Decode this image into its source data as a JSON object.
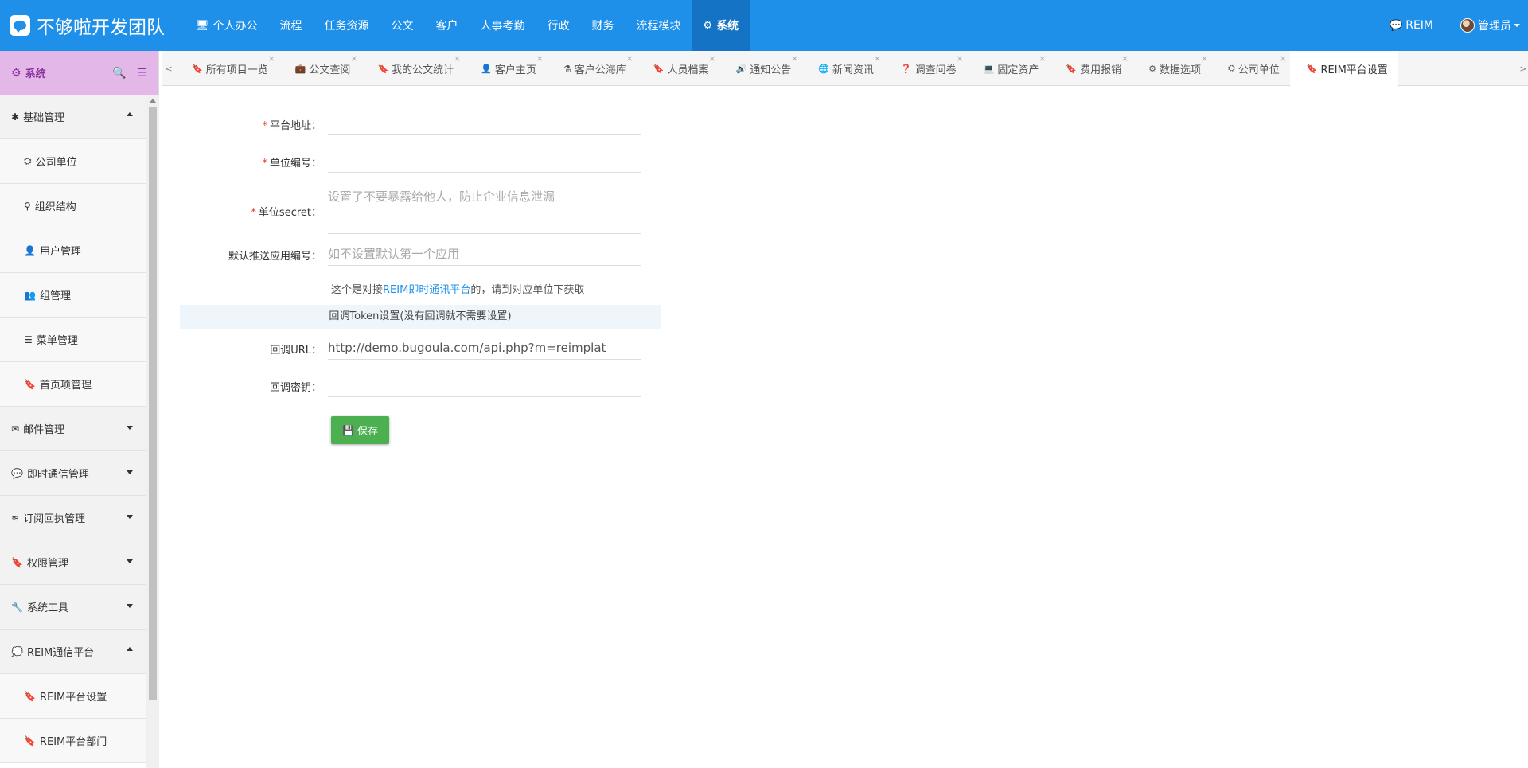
{
  "app": {
    "title": "不够啦开发团队"
  },
  "colors": {
    "primary": "#1e90ea",
    "nav_active": "#1573c5",
    "sidebar_header": "#e3b8e8",
    "required": "#e53935",
    "save_button": "#4caf50",
    "section_bg": "#eef5fb"
  },
  "topnav": {
    "items": [
      {
        "label": "个人办公",
        "icon": "desktop-icon",
        "glyph": "🖥"
      },
      {
        "label": "流程"
      },
      {
        "label": "任务资源"
      },
      {
        "label": "公文"
      },
      {
        "label": "客户"
      },
      {
        "label": "人事考勤"
      },
      {
        "label": "行政"
      },
      {
        "label": "财务"
      },
      {
        "label": "流程模块"
      },
      {
        "label": "系统",
        "icon": "gear-icon",
        "glyph": "⚙",
        "active": true
      }
    ],
    "right": {
      "reim_label": "REIM",
      "user_label": "管理员"
    }
  },
  "sidebar": {
    "title": "系统",
    "items": [
      {
        "label": "基础管理",
        "type": "group",
        "icon": "asterisk-icon",
        "glyph": "✱",
        "expanded": true
      },
      {
        "label": "公司单位",
        "type": "sub",
        "icon": "binoculars-icon",
        "glyph": "⛭"
      },
      {
        "label": "组织结构",
        "type": "sub",
        "icon": "sitemap-icon",
        "glyph": "⚲"
      },
      {
        "label": "用户管理",
        "type": "sub",
        "icon": "user-icon",
        "glyph": "👤"
      },
      {
        "label": "组管理",
        "type": "sub",
        "icon": "users-icon",
        "glyph": "👥"
      },
      {
        "label": "菜单管理",
        "type": "sub",
        "icon": "list-icon",
        "glyph": "☰"
      },
      {
        "label": "首页项管理",
        "type": "sub",
        "icon": "bookmark-icon",
        "glyph": "🔖"
      },
      {
        "label": "邮件管理",
        "type": "group",
        "icon": "envelope-icon",
        "glyph": "✉",
        "expanded": false
      },
      {
        "label": "即时通信管理",
        "type": "group",
        "icon": "comment-icon",
        "glyph": "💬",
        "expanded": false
      },
      {
        "label": "订阅回执管理",
        "type": "group",
        "icon": "rss-icon",
        "glyph": "≋",
        "expanded": false
      },
      {
        "label": "权限管理",
        "type": "group",
        "icon": "bookmark-icon",
        "glyph": "🔖",
        "expanded": false
      },
      {
        "label": "系统工具",
        "type": "group",
        "icon": "wrench-icon",
        "glyph": "🔧",
        "expanded": false
      },
      {
        "label": "REIM通信平台",
        "type": "group",
        "icon": "comment-o-icon",
        "glyph": "💭",
        "expanded": true
      },
      {
        "label": "REIM平台设置",
        "type": "sub",
        "icon": "bookmark-icon",
        "glyph": "🔖"
      },
      {
        "label": "REIM平台部门",
        "type": "sub",
        "icon": "bookmark-icon",
        "glyph": "🔖"
      }
    ]
  },
  "tabs": [
    {
      "label": "所有项目一览",
      "icon": "bookmark-icon",
      "glyph": "🔖"
    },
    {
      "label": "公文查阅",
      "icon": "briefcase-icon",
      "glyph": "💼"
    },
    {
      "label": "我的公文统计",
      "icon": "bookmark-icon",
      "glyph": "🔖"
    },
    {
      "label": "客户主页",
      "icon": "user-tie-icon",
      "glyph": "👤"
    },
    {
      "label": "客户公海库",
      "icon": "flask-icon",
      "glyph": "⚗"
    },
    {
      "label": "人员档案",
      "icon": "bookmark-icon",
      "glyph": "🔖"
    },
    {
      "label": "通知公告",
      "icon": "volume-icon",
      "glyph": "🔊"
    },
    {
      "label": "新闻资讯",
      "icon": "globe-icon",
      "glyph": "🌐"
    },
    {
      "label": "调查问卷",
      "icon": "question-circle-icon",
      "glyph": "❓"
    },
    {
      "label": "固定资产",
      "icon": "laptop-icon",
      "glyph": "💻"
    },
    {
      "label": "费用报销",
      "icon": "bookmark-icon",
      "glyph": "🔖"
    },
    {
      "label": "数据选项",
      "icon": "gear-icon",
      "glyph": "⚙"
    },
    {
      "label": "公司单位",
      "icon": "binoculars-icon",
      "glyph": "⛭"
    },
    {
      "label": "REIM平台设置",
      "icon": "bookmark-icon",
      "glyph": "🔖",
      "active": true
    }
  ],
  "form": {
    "platform_url": {
      "label": "平台地址：",
      "required": true,
      "value": "",
      "placeholder": ""
    },
    "unit_id": {
      "label": "单位编号：",
      "required": true,
      "value": "",
      "placeholder": ""
    },
    "unit_secret": {
      "label": "单位secret：",
      "required": true,
      "value": "",
      "placeholder": "设置了不要暴露给他人，防止企业信息泄漏"
    },
    "push_app_id": {
      "label": "默认推送应用编号：",
      "required": false,
      "value": "",
      "placeholder": "如不设置默认第一个应用"
    },
    "hint": {
      "prefix": "这个是对接",
      "link": "REIM即时通讯平台",
      "suffix": "的，请到对应单位下获取"
    },
    "section_title": "回调Token设置(没有回调就不需要设置)",
    "callback_url": {
      "label": "回调URL：",
      "value": "http://demo.bugoula.com/api.php?m=reimplat"
    },
    "callback_key": {
      "label": "回调密钥：",
      "value": ""
    },
    "save_label": "保存"
  }
}
